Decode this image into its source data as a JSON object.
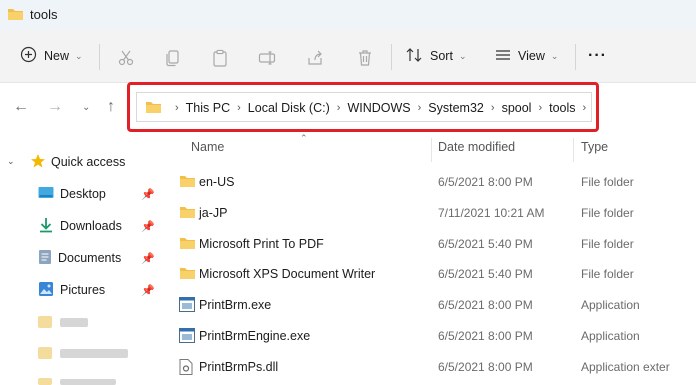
{
  "window": {
    "title": "tools"
  },
  "toolbar": {
    "new_label": "New",
    "sort_label": "Sort",
    "view_label": "View",
    "more_label": "···"
  },
  "breadcrumb": {
    "items": [
      "This PC",
      "Local Disk (C:)",
      "WINDOWS",
      "System32",
      "spool",
      "tools"
    ],
    "trailing_separator": "›"
  },
  "sidebar": {
    "quick_access": "Quick access",
    "items": [
      {
        "label": "Desktop",
        "icon": "desktop-icon"
      },
      {
        "label": "Downloads",
        "icon": "download-icon"
      },
      {
        "label": "Documents",
        "icon": "documents-icon"
      },
      {
        "label": "Pictures",
        "icon": "pictures-icon"
      }
    ]
  },
  "columns": {
    "name": "Name",
    "date": "Date modified",
    "type": "Type"
  },
  "files": [
    {
      "name": "en-US",
      "date": "6/5/2021 8:00 PM",
      "type": "File folder",
      "icon": "folder-icon"
    },
    {
      "name": "ja-JP",
      "date": "7/11/2021 10:21 AM",
      "type": "File folder",
      "icon": "folder-icon"
    },
    {
      "name": "Microsoft Print To PDF",
      "date": "6/5/2021 5:40 PM",
      "type": "File folder",
      "icon": "folder-icon"
    },
    {
      "name": "Microsoft XPS Document Writer",
      "date": "6/5/2021 5:40 PM",
      "type": "File folder",
      "icon": "folder-icon"
    },
    {
      "name": "PrintBrm.exe",
      "date": "6/5/2021 8:00 PM",
      "type": "Application",
      "icon": "application-icon"
    },
    {
      "name": "PrintBrmEngine.exe",
      "date": "6/5/2021 8:00 PM",
      "type": "Application",
      "icon": "application-icon"
    },
    {
      "name": "PrintBrmPs.dll",
      "date": "6/5/2021 8:00 PM",
      "type": "Application exter",
      "icon": "dll-icon"
    }
  ],
  "colors": {
    "highlight_border": "#e01f27",
    "folder": "#f2c04a",
    "star": "#f5b800",
    "toolbar_bg": "#f3f3f3"
  }
}
